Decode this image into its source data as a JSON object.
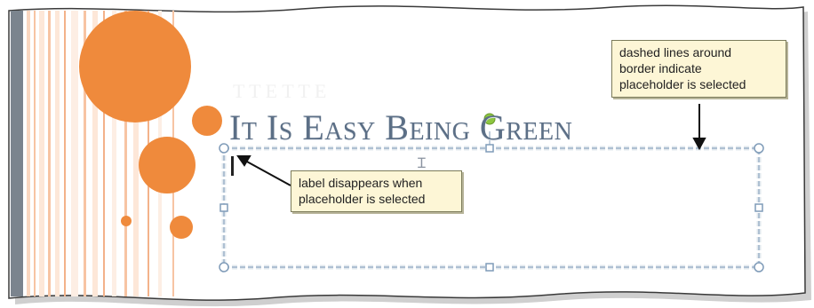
{
  "slide": {
    "title": "It Is Easy Being Green"
  },
  "callouts": {
    "selected": {
      "lines": [
        "dashed lines around",
        "border indicate",
        "placeholder is selected"
      ]
    },
    "label": {
      "lines": [
        "label disappears when",
        "placeholder is selected"
      ]
    }
  },
  "colors": {
    "accent_orange": "#ef8a3c",
    "title_blue": "#5c6f86",
    "callout_bg": "#fdf6d6"
  },
  "icons": {
    "rotation_handle": "green-dot",
    "sizing_handle": "circle",
    "text_cursor": "i-beam"
  }
}
